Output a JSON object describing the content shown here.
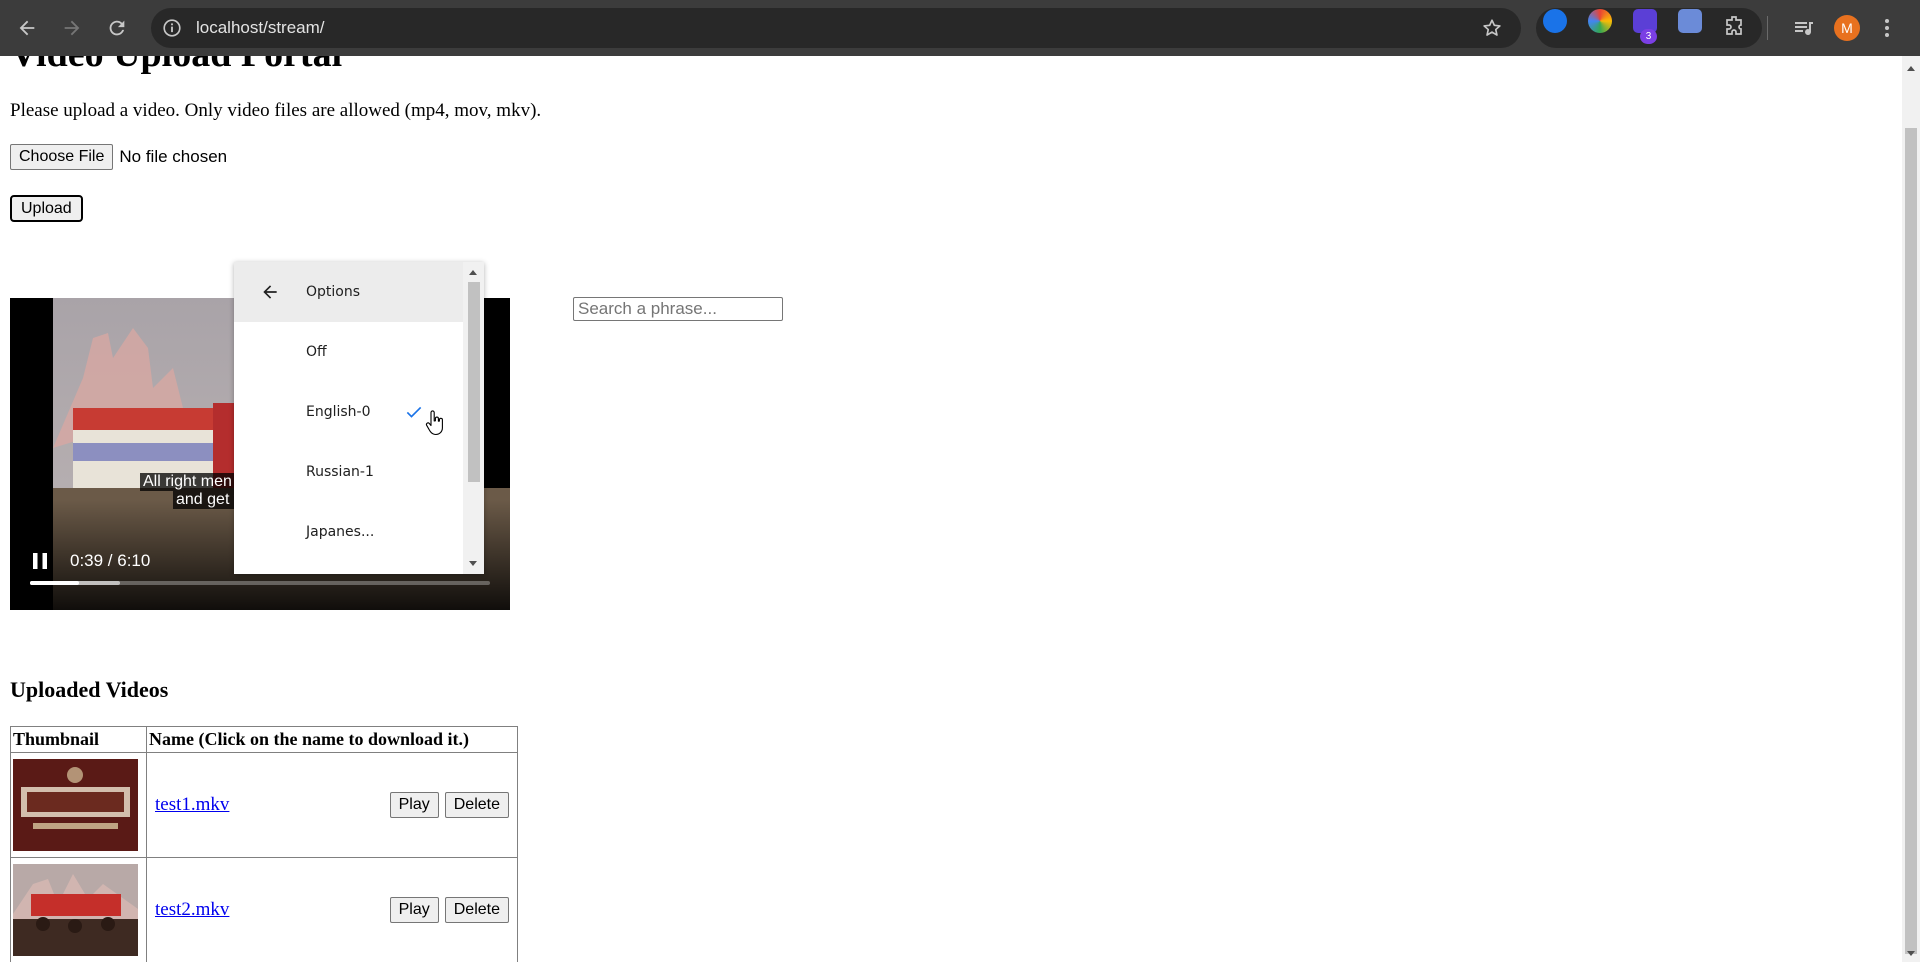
{
  "browser": {
    "url": "localhost/stream/",
    "extension_badge": "3",
    "profile_initial": "M",
    "colors": {
      "chrome_bg": "#3c3c3c",
      "omnibox_bg": "#282828",
      "avatar": "#e8711f"
    },
    "icons": [
      "back-arrow-icon",
      "forward-arrow-icon",
      "reload-icon",
      "site-info-icon",
      "bookmark-star-icon",
      "extensions-puzzle-icon",
      "media-queue-icon",
      "kebab-menu-icon"
    ]
  },
  "page": {
    "title": "Video Upload Portal",
    "intro": "Please upload a video. Only video files are allowed (mp4, mov, mkv).",
    "choose_file_label": "Choose File",
    "file_status": "No file chosen",
    "upload_label": "Upload"
  },
  "player": {
    "time": "0:39 / 6:10",
    "caption_line1": "All right men",
    "caption_line2": "and get y",
    "progress_played": 0.106,
    "progress_buffered": 0.195
  },
  "captions_menu": {
    "header": "Options",
    "items": [
      {
        "label": "Off",
        "selected": false
      },
      {
        "label": "English-0",
        "selected": true
      },
      {
        "label": "Russian-1",
        "selected": false
      },
      {
        "label": "Japanes...",
        "selected": false
      }
    ]
  },
  "search": {
    "placeholder": "Search a phrase..."
  },
  "uploaded": {
    "title": "Uploaded Videos",
    "headers": [
      "Thumbnail",
      "Name (Click on the name to download it.)"
    ],
    "rows": [
      {
        "name": "test1.mkv",
        "play": "Play",
        "delete": "Delete"
      },
      {
        "name": "test2.mkv",
        "play": "Play",
        "delete": "Delete"
      }
    ]
  }
}
